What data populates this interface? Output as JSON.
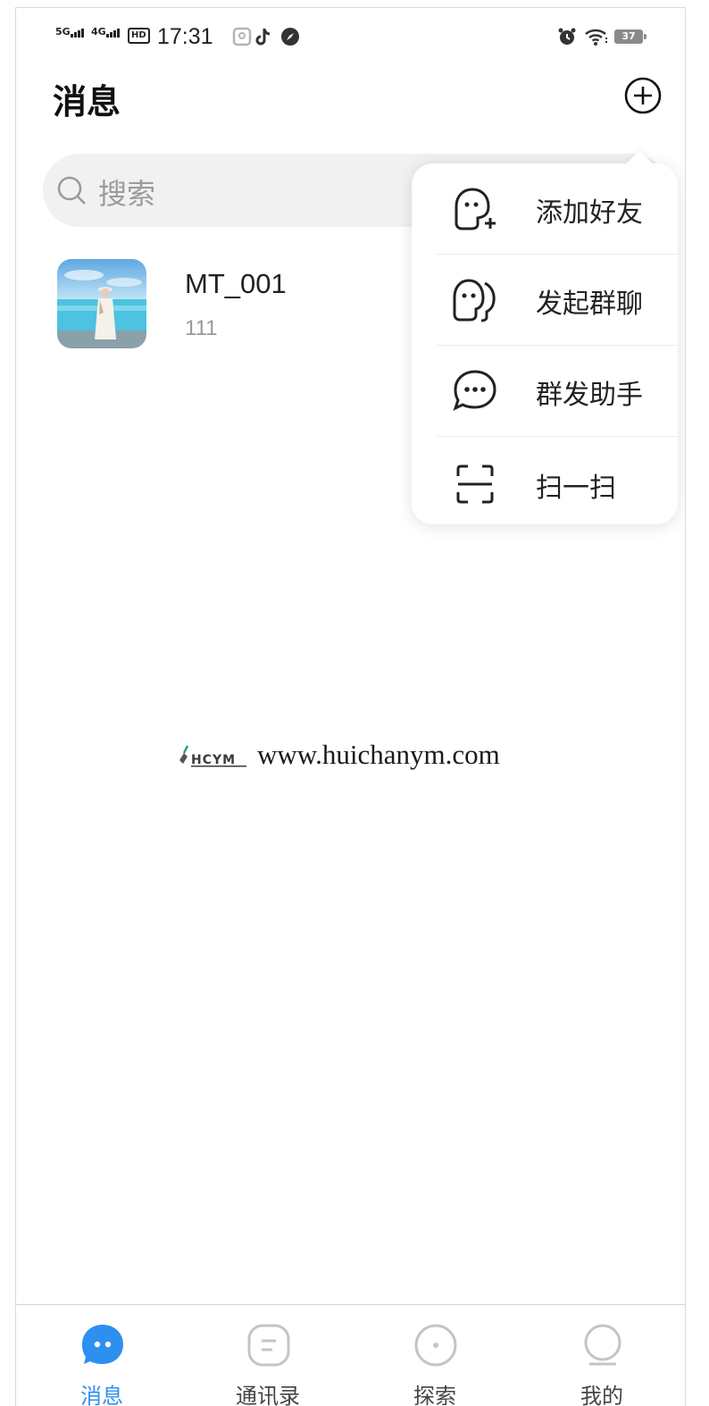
{
  "status_bar": {
    "sim1": "5G",
    "sim2": "4G",
    "hd": "HD",
    "time": "17:31",
    "battery": "37"
  },
  "header": {
    "title": "消息"
  },
  "search": {
    "placeholder": "搜索"
  },
  "conversations": [
    {
      "name": "MT_001",
      "preview": "111"
    }
  ],
  "popup_menu": {
    "items": [
      {
        "label": "添加好友",
        "icon": "add-friend-icon"
      },
      {
        "label": "发起群聊",
        "icon": "group-chat-icon"
      },
      {
        "label": "群发助手",
        "icon": "broadcast-chat-icon"
      },
      {
        "label": "扫一扫",
        "icon": "scan-icon"
      }
    ]
  },
  "watermark": {
    "logo_text": "HCYM",
    "url": "www.huichanym.com"
  },
  "tabbar": {
    "active": "消息",
    "accent_color": "#2d8ff0",
    "tabs": [
      {
        "label": "消息",
        "icon": "message-icon"
      },
      {
        "label": "通讯录",
        "icon": "contacts-icon"
      },
      {
        "label": "探索",
        "icon": "explore-icon"
      },
      {
        "label": "我的",
        "icon": "profile-icon"
      }
    ]
  }
}
